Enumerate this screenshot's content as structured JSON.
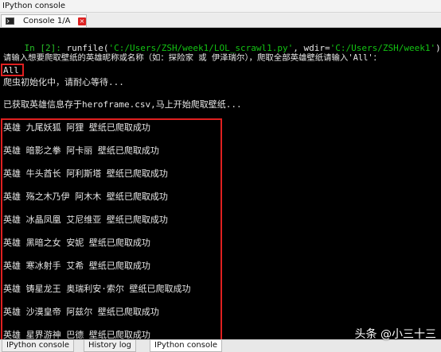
{
  "window": {
    "title": "IPython console"
  },
  "tab": {
    "label": "Console 1/A",
    "close_glyph": "×"
  },
  "console": {
    "prompt": "In [2]:",
    "command_pre": " runfile(",
    "arg1": "'C:/Users/ZSH/week1/LOL_scrawl1.py'",
    "command_mid": ", wdir=",
    "arg2": "'C:/Users/ZSH/week1'",
    "command_post": ")",
    "ask_line": "请输入想要爬取壁纸的英雄昵称或名称（如：探险家 或 伊泽瑞尔），爬取全部英雄壁纸请输入'All'：",
    "input_value": "All",
    "init_line": "爬虫初始化中，请耐心等待...",
    "saved_line": "已获取英雄信息存于heroframe.csv,马上开始爬取壁纸...",
    "results": [
      "英雄 九尾妖狐 阿狸 壁纸已爬取成功",
      "英雄 暗影之拳 阿卡丽 壁纸已爬取成功",
      "英雄 牛头酋长 阿利斯塔 壁纸已爬取成功",
      "英雄 殇之木乃伊 阿木木 壁纸已爬取成功",
      "英雄 冰晶凤凰 艾尼维亚 壁纸已爬取成功",
      "英雄 黑暗之女 安妮 壁纸已爬取成功",
      "英雄 寒冰射手 艾希 壁纸已爬取成功",
      "英雄 铸星龙王 奥瑞利安·索尔 壁纸已爬取成功",
      "英雄 沙漠皇帝 阿兹尔 壁纸已爬取成功",
      "英雄 星界游神 巴德 壁纸已爬取成功"
    ]
  },
  "bottom_tabs": [
    "IPython console",
    "History log",
    "IPython console"
  ],
  "watermark": "头条 @小三十三",
  "colors": {
    "highlight_box": "#e02020",
    "prompt": "#27c027",
    "string": "#13c413"
  },
  "icons": {
    "tab": "console-icon"
  }
}
